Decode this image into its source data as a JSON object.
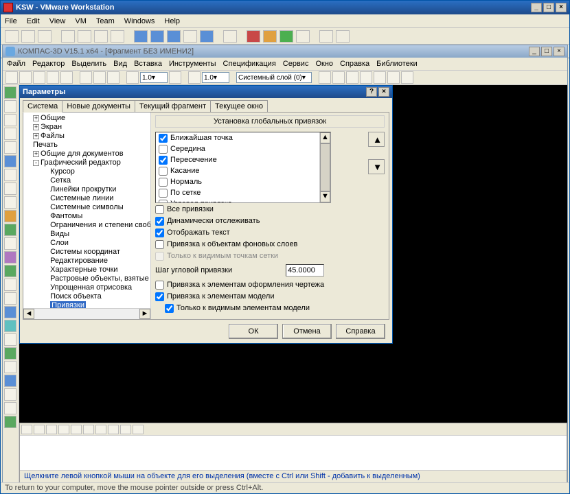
{
  "outer": {
    "title": "KSW - VMware Workstation",
    "menu": [
      "File",
      "Edit",
      "View",
      "VM",
      "Team",
      "Windows",
      "Help"
    ],
    "tab": "KSW",
    "status": "To return to your computer, move the mouse pointer outside or press Ctrl+Alt."
  },
  "kompas": {
    "title": "КОМПАС-3D V15.1 x64 - [Фрагмент БЕЗ ИМЕНИ2]",
    "menu": [
      "Файл",
      "Редактор",
      "Выделить",
      "Вид",
      "Вставка",
      "Инструменты",
      "Спецификация",
      "Сервис",
      "Окно",
      "Справка",
      "Библиотеки"
    ],
    "zoom1": "1.0",
    "zoom2": "1.0",
    "layer": "Системный слой (0)",
    "status": "Щелкните левой кнопкой мыши на объекте для его выделения (вместе с Ctrl или Shift - добавить к выделенным)"
  },
  "dialog": {
    "title": "Параметры",
    "tabs": [
      "Система",
      "Новые документы",
      "Текущий фрагмент",
      "Текущее окно"
    ],
    "active_tab": 0,
    "tree": [
      {
        "lvl": 1,
        "exp": "+",
        "label": "Общие"
      },
      {
        "lvl": 1,
        "exp": "+",
        "label": "Экран"
      },
      {
        "lvl": 1,
        "exp": "+",
        "label": "Файлы"
      },
      {
        "lvl": 1,
        "exp": "",
        "label": "Печать"
      },
      {
        "lvl": 1,
        "exp": "+",
        "label": "Общие для документов"
      },
      {
        "lvl": 1,
        "exp": "-",
        "label": "Графический редактор"
      },
      {
        "lvl": 2,
        "exp": "",
        "label": "Курсор"
      },
      {
        "lvl": 2,
        "exp": "",
        "label": "Сетка"
      },
      {
        "lvl": 2,
        "exp": "",
        "label": "Линейки прокрутки"
      },
      {
        "lvl": 2,
        "exp": "",
        "label": "Системные линии"
      },
      {
        "lvl": 2,
        "exp": "",
        "label": "Системные символы"
      },
      {
        "lvl": 2,
        "exp": "",
        "label": "Фантомы"
      },
      {
        "lvl": 2,
        "exp": "",
        "label": "Ограничения и степени свободы"
      },
      {
        "lvl": 2,
        "exp": "",
        "label": "Виды"
      },
      {
        "lvl": 2,
        "exp": "",
        "label": "Слои"
      },
      {
        "lvl": 2,
        "exp": "",
        "label": "Системы координат"
      },
      {
        "lvl": 2,
        "exp": "",
        "label": "Редактирование"
      },
      {
        "lvl": 2,
        "exp": "",
        "label": "Характерные точки"
      },
      {
        "lvl": 2,
        "exp": "",
        "label": "Растровые объекты, взятые в документ"
      },
      {
        "lvl": 2,
        "exp": "",
        "label": "Упрощенная отрисовка"
      },
      {
        "lvl": 2,
        "exp": "",
        "label": "Поиск объекта"
      },
      {
        "lvl": 2,
        "exp": "",
        "label": "Привязки",
        "sel": true
      }
    ],
    "panel_title": "Установка глобальных привязок",
    "snaps": [
      {
        "label": "Ближайшая точка",
        "checked": true
      },
      {
        "label": "Середина",
        "checked": false
      },
      {
        "label": "Пересечение",
        "checked": true
      },
      {
        "label": "Касание",
        "checked": false
      },
      {
        "label": "Нормаль",
        "checked": false
      },
      {
        "label": "По сетке",
        "checked": false
      },
      {
        "label": "Угловая привязка",
        "checked": false
      }
    ],
    "opts": {
      "all": {
        "label": "Все привязки",
        "checked": false
      },
      "dynamic": {
        "label": "Динамически отслеживать",
        "checked": true
      },
      "showtext": {
        "label": "Отображать текст",
        "checked": true
      },
      "bglayers": {
        "label": "Привязка к объектам фоновых слоев",
        "checked": false
      },
      "gridvisible": {
        "label": "Только к видимым точкам сетки",
        "checked": false,
        "disabled": true
      },
      "steplabel": "Шаг угловой привязки",
      "stepvalue": "45.0000",
      "drawing": {
        "label": "Привязка к элементам оформления чертежа",
        "checked": false
      },
      "model": {
        "label": "Привязка к элементам модели",
        "checked": true
      },
      "modelvis": {
        "label": "Только к видимым элементам модели",
        "checked": true
      }
    },
    "buttons": {
      "ok": "ОК",
      "cancel": "Отмена",
      "help": "Справка"
    }
  }
}
